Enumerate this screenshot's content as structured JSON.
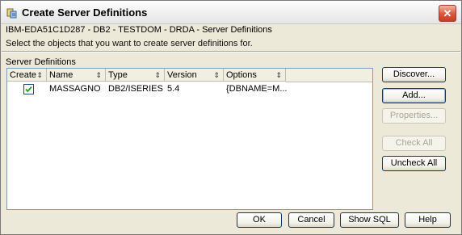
{
  "window": {
    "title": "Create Server Definitions",
    "close_glyph": "✕"
  },
  "subtitle": "IBM-EDA51C1D287 - DB2 - TESTDOM - DRDA - Server Definitions",
  "description": "Select the objects that you want to create server definitions for.",
  "group_label": "Server Definitions",
  "table": {
    "columns": [
      "Create",
      "Name",
      "Type",
      "Version",
      "Options"
    ],
    "sort_glyph": "⇕",
    "rows": [
      {
        "create": true,
        "name": "MASSAGNO",
        "type": "DB2/ISERIES",
        "version": "5.4",
        "options": "{DBNAME=M..."
      }
    ]
  },
  "side_buttons": {
    "discover": "Discover...",
    "add": "Add...",
    "properties": "Properties...",
    "check_all": "Check All",
    "uncheck_all": "Uncheck All"
  },
  "footer_buttons": {
    "ok": "OK",
    "cancel": "Cancel",
    "show_sql": "Show SQL",
    "help": "Help"
  },
  "icons": {
    "title": "server-definitions-icon",
    "close": "close-icon",
    "checkbox": "checkmark-icon"
  },
  "colors": {
    "dialog_bg": "#ece9d8",
    "close_button": "#d9553b",
    "checkmark": "#21a121"
  }
}
